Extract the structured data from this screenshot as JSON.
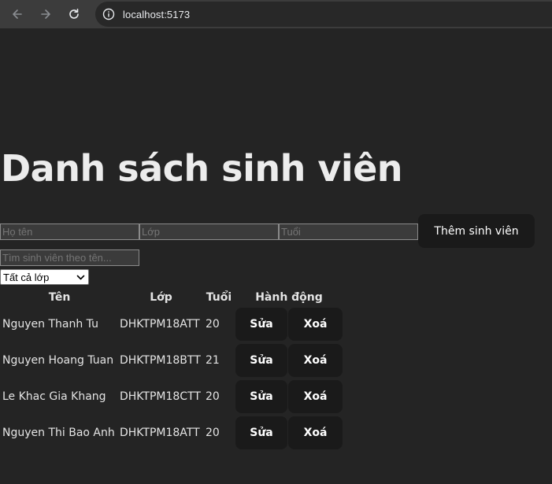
{
  "browser": {
    "url": "localhost:5173",
    "back_icon": "arrow-left-icon",
    "forward_icon": "arrow-right-icon",
    "reload_icon": "reload-icon",
    "site_info_icon": "info-icon"
  },
  "page": {
    "title": "Danh sách sinh viên"
  },
  "form": {
    "name_placeholder": "Họ tên",
    "class_placeholder": "Lớp",
    "age_placeholder": "Tuổi",
    "add_button_label": "Thêm sinh viên"
  },
  "search": {
    "placeholder": "Tìm sinh viên theo tên..."
  },
  "filter": {
    "selected": "Tất cả lớp"
  },
  "table": {
    "headers": [
      "Tên",
      "Lớp",
      "Tuổi",
      "Hành động"
    ],
    "edit_label": "Sửa",
    "delete_label": "Xoá",
    "rows": [
      {
        "name": "Nguyen Thanh Tu",
        "class": "DHKTPM18ATT",
        "age": "20"
      },
      {
        "name": "Nguyen Hoang Tuan",
        "class": "DHKTPM18BTT",
        "age": "21"
      },
      {
        "name": "Le Khac Gia Khang",
        "class": "DHKTPM18CTT",
        "age": "20"
      },
      {
        "name": "Nguyen Thi Bao Anh",
        "class": "DHKTPM18ATT",
        "age": "20"
      }
    ]
  },
  "colors": {
    "background": "#242424",
    "button_bg": "#1a1a1a",
    "browser_bar": "#3c3c3c"
  }
}
